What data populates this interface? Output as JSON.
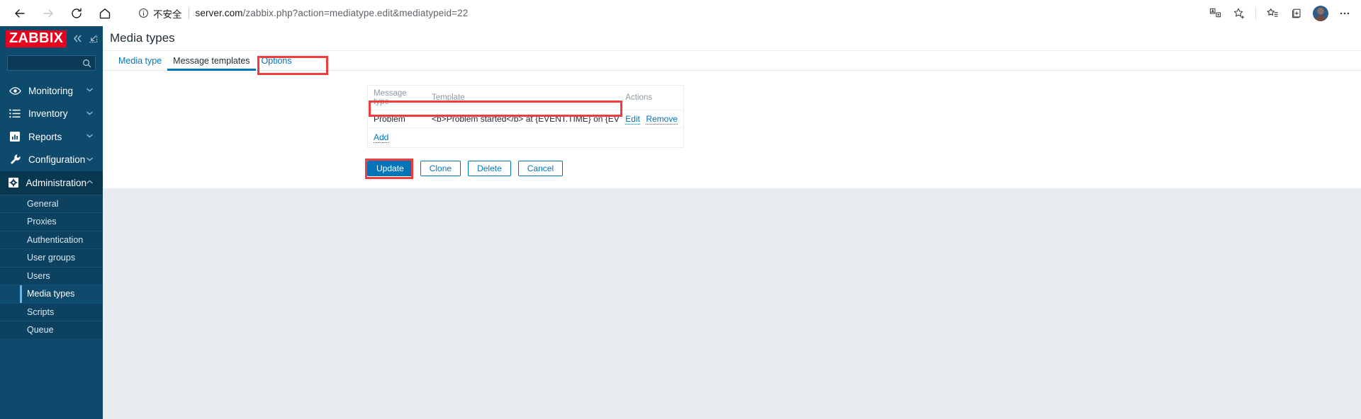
{
  "browser": {
    "back_icon": "arrow-left-icon",
    "forward_icon": "arrow-right-icon",
    "reload_icon": "reload-icon",
    "home_icon": "home-icon",
    "security_icon": "info-circle-icon",
    "security_label": "不安全",
    "url_host": "server.com",
    "url_path": "/zabbix.php?action=mediatype.edit&mediatypeid=22",
    "right_icons": [
      "translate-icon",
      "add-favorite-icon",
      "favorites-icon",
      "collections-icon",
      "profile-avatar",
      "settings-more-icon"
    ]
  },
  "sidebar": {
    "logo_text": "ZABBIX",
    "collapse_icon": "chevron-double-left-icon",
    "expand_icon": "collapse-panel-icon",
    "search_placeholder": "",
    "search_icon": "search-icon",
    "menu": [
      {
        "label": "Monitoring",
        "icon": "eye-icon",
        "arrow": "chevron-down-icon",
        "expanded": false
      },
      {
        "label": "Inventory",
        "icon": "list-icon",
        "arrow": "chevron-down-icon",
        "expanded": false
      },
      {
        "label": "Reports",
        "icon": "chart-bar-icon",
        "arrow": "chevron-down-icon",
        "expanded": false
      },
      {
        "label": "Configuration",
        "icon": "wrench-icon",
        "arrow": "chevron-down-icon",
        "expanded": false
      },
      {
        "label": "Administration",
        "icon": "gear-icon",
        "arrow": "chevron-up-icon",
        "expanded": true
      }
    ],
    "submenu": [
      {
        "label": "General",
        "selected": false
      },
      {
        "label": "Proxies",
        "selected": false
      },
      {
        "label": "Authentication",
        "selected": false
      },
      {
        "label": "User groups",
        "selected": false
      },
      {
        "label": "Users",
        "selected": false
      },
      {
        "label": "Media types",
        "selected": true
      },
      {
        "label": "Scripts",
        "selected": false
      },
      {
        "label": "Queue",
        "selected": false
      }
    ]
  },
  "main": {
    "page_title": "Media types",
    "tabs": [
      {
        "label": "Media type",
        "active": false
      },
      {
        "label": "Message templates",
        "active": true
      },
      {
        "label": "Options",
        "active": false
      }
    ],
    "table": {
      "headers": [
        "Message type",
        "Template",
        "Actions"
      ],
      "rows": [
        {
          "message_type": "Problem",
          "template": "<b>Problem started</b> at {EVENT.TIME} on {EVENT.DATE.",
          "actions": [
            "Edit",
            "Remove"
          ]
        }
      ],
      "add_label": "Add"
    },
    "buttons": [
      {
        "label": "Update",
        "style": "primary"
      },
      {
        "label": "Clone",
        "style": "secondary"
      },
      {
        "label": "Delete",
        "style": "secondary"
      },
      {
        "label": "Cancel",
        "style": "secondary"
      }
    ]
  },
  "annotations": {
    "color": "#f03c3c",
    "targets": [
      "message-templates-tab",
      "template-table-row",
      "update-button"
    ]
  }
}
